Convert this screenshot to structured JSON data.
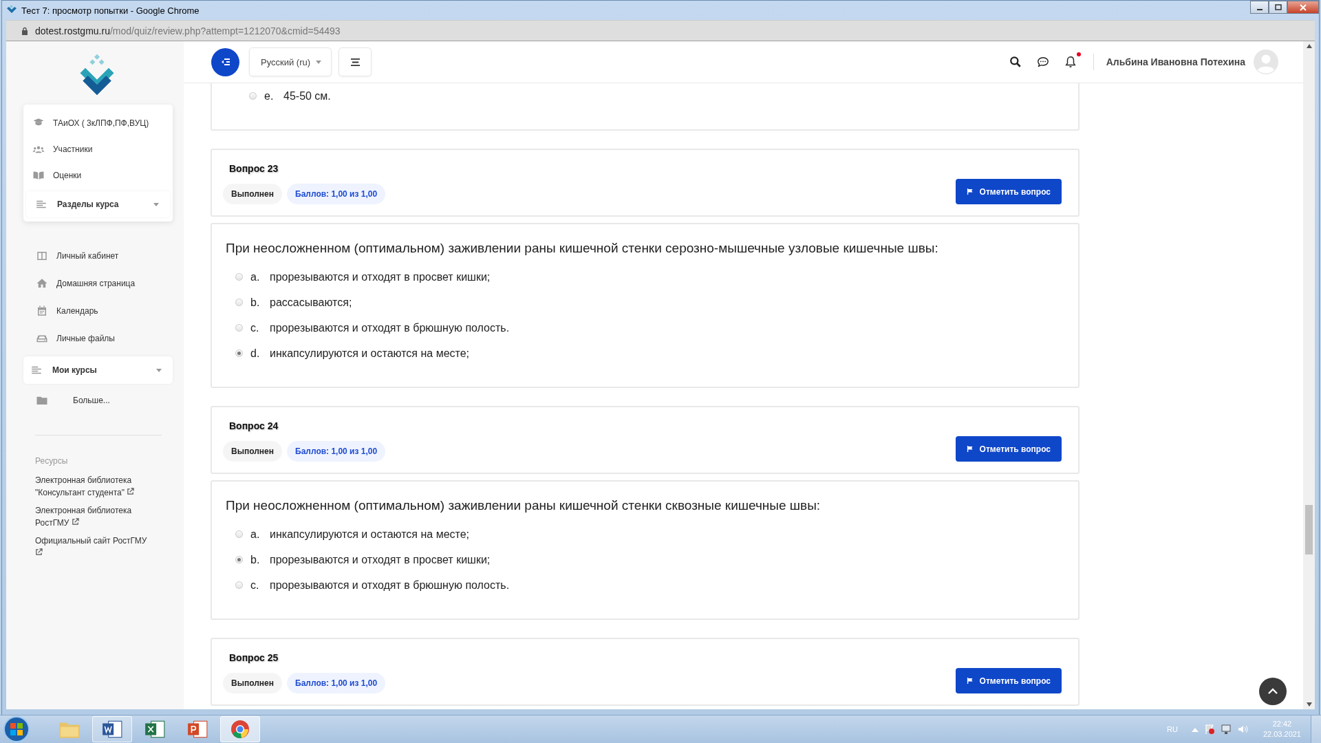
{
  "window": {
    "title": "Тест 7: просмотр попытки - Google Chrome"
  },
  "address_bar": {
    "host": "dotest.rostgmu.ru",
    "path": "/mod/quiz/review.php?attempt=1212070&cmid=54493"
  },
  "navbar": {
    "language": "Русский (ru)",
    "notification_unread": true,
    "user_name": "Альбина Ивановна Потехина"
  },
  "sidebar": {
    "course_items": [
      "ТАиОХ ( 3кЛПФ,ПФ,ВУЦ)",
      "Участники",
      "Оценки"
    ],
    "course_sections": "Разделы курса",
    "nav_items": [
      "Личный кабинет",
      "Домашняя страница",
      "Календарь",
      "Личные файлы"
    ],
    "my_courses": "Мои курсы",
    "more": "Больше...",
    "resources_heading": "Ресурсы",
    "resources": [
      "Электронная библиотека \"Консультант студента\"",
      "Электронная библиотека РостГМУ",
      "Официальный сайт РостГМУ"
    ]
  },
  "partial_question": {
    "answers": [
      {
        "letter": "e.",
        "text": "45-50 см.",
        "selected": false
      }
    ]
  },
  "questions": [
    {
      "title": "Вопрос 23",
      "state": "Выполнен",
      "grade": "Баллов: 1,00 из 1,00",
      "flag_button": "Отметить вопрос",
      "prompt": "При неосложненном (оптимальном) заживлении раны кишечной стенки серозно-мышечные узловые кишечные швы:",
      "answers": [
        {
          "letter": "a.",
          "text": "прорезываются и отходят в просвет кишки;",
          "selected": false
        },
        {
          "letter": "b.",
          "text": "рассасываются;",
          "selected": false
        },
        {
          "letter": "c.",
          "text": "прорезываются и отходят в брюшную полость.",
          "selected": false
        },
        {
          "letter": "d.",
          "text": "инкапсулируются и остаются на месте;",
          "selected": true
        }
      ]
    },
    {
      "title": "Вопрос 24",
      "state": "Выполнен",
      "grade": "Баллов: 1,00 из 1,00",
      "flag_button": "Отметить вопрос",
      "prompt": "При неосложненном (оптимальном) заживлении раны кишечной стенки сквозные кишечные швы:",
      "answers": [
        {
          "letter": "a.",
          "text": "инкапсулируются и остаются на месте;",
          "selected": false
        },
        {
          "letter": "b.",
          "text": "прорезываются и отходят в просвет кишки;",
          "selected": true
        },
        {
          "letter": "c.",
          "text": "прорезываются и отходят в брюшную полость.",
          "selected": false
        }
      ]
    },
    {
      "title": "Вопрос 25",
      "state": "Выполнен",
      "grade": "Баллов: 1,00 из 1,00",
      "flag_button": "Отметить вопрос"
    }
  ],
  "taskbar": {
    "language": "RU",
    "time": "22:42",
    "date": "22.03.2021"
  }
}
